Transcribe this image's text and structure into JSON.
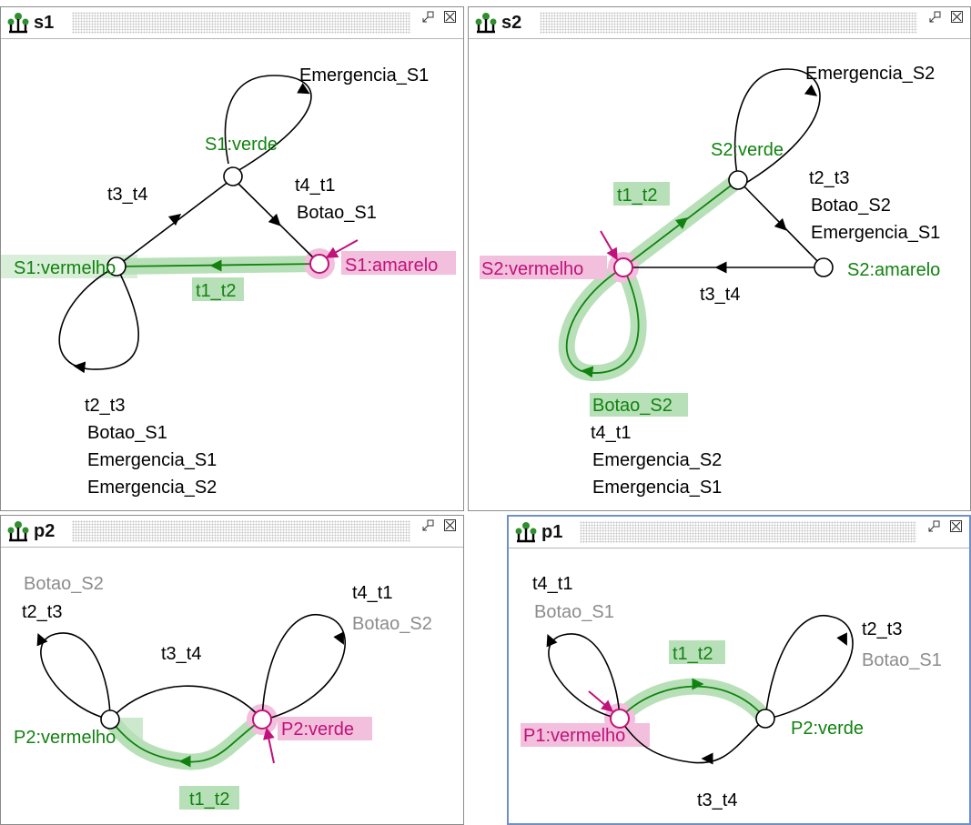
{
  "colors": {
    "green": "#11820f",
    "magenta": "#c0127a",
    "highlight_green": "#b8e0b8",
    "highlight_pink": "#f2bfdc",
    "inactive_label": "#8c8c8c",
    "active_frame": "#6f8fc6"
  },
  "window_icons": [
    "tree-icon",
    "restore-icon",
    "close-icon"
  ],
  "panels": {
    "s1": {
      "title": "s1",
      "states": {
        "verde": "S1:verde",
        "vermelho": "S1:vermelho",
        "amarelo": "S1:amarelo"
      },
      "labels": {
        "loop_verde": "Emergencia_S1",
        "t3_t4": "t3_t4",
        "t4_t1_title": "t4_t1",
        "t4_t1_event": "Botao_S1",
        "t1_t2": "t1_t2",
        "t2_t3_title": "t2_t3",
        "t2_t3_e1": "Botao_S1",
        "t2_t3_e2": "Emergencia_S1",
        "t2_t3_e3": "Emergencia_S2"
      }
    },
    "s2": {
      "title": "s2",
      "states": {
        "verde": "S2:verde",
        "vermelho": "S2:vermelho",
        "amarelo": "S2:amarelo"
      },
      "labels": {
        "loop_verde": "Emergencia_S2",
        "t1_t2": "t1_t2",
        "t2_t3_title": "t2_t3",
        "t2_t3_e1": "Botao_S2",
        "t2_t3_e2": "Emergencia_S1",
        "t3_t4": "t3_t4",
        "botao_loop": "Botao_S2",
        "t4_t1_title": "t4_t1",
        "t4_t1_e1": "Emergencia_S2",
        "t4_t1_e2": "Emergencia_S1"
      }
    },
    "p2": {
      "title": "p2",
      "states": {
        "vermelho": "P2:vermelho",
        "verde": "P2:verde"
      },
      "labels": {
        "left_loop_event": "Botao_S2",
        "left_loop_title": "t2_t3",
        "t3_t4": "t3_t4",
        "right_loop_title": "t4_t1",
        "right_loop_event": "Botao_S2",
        "t1_t2": "t1_t2"
      }
    },
    "p1": {
      "title": "p1",
      "states": {
        "vermelho": "P1:vermelho",
        "verde": "P2:verde"
      },
      "labels": {
        "left_loop_title": "t4_t1",
        "left_loop_event": "Botao_S1",
        "t1_t2": "t1_t2",
        "right_loop_title": "t2_t3",
        "right_loop_event": "Botao_S1",
        "t3_t4": "t3_t4"
      }
    }
  }
}
